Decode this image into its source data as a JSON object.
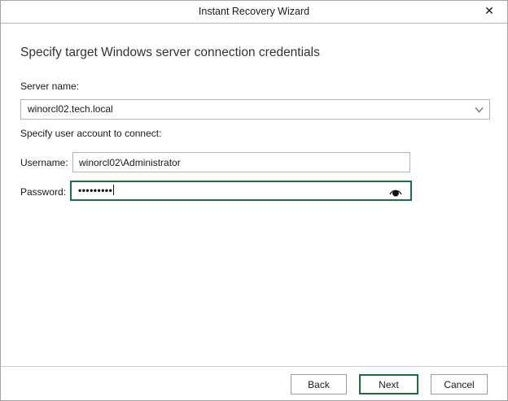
{
  "window": {
    "title": "Instant Recovery Wizard",
    "close_glyph": "✕"
  },
  "content": {
    "heading": "Specify target Windows server connection credentials",
    "server_name_label": "Server name:",
    "server_name_value": "winorcl02.tech.local",
    "user_account_label": "Specify user account to connect:",
    "username_label": "Username:",
    "username_value": "winorcl02\\Administrator",
    "password_label": "Password:",
    "password_masked_value": "•••••••••"
  },
  "footer": {
    "back_label": "Back",
    "next_label": "Next",
    "cancel_label": "Cancel"
  },
  "icons": {
    "chevron": "chevron-down-icon",
    "eye": "reveal-password-icon",
    "close": "close-icon"
  },
  "colors": {
    "accent_green": "#1e6e44",
    "border_gray": "#b0b4ba",
    "window_border": "#a5a5a5"
  }
}
